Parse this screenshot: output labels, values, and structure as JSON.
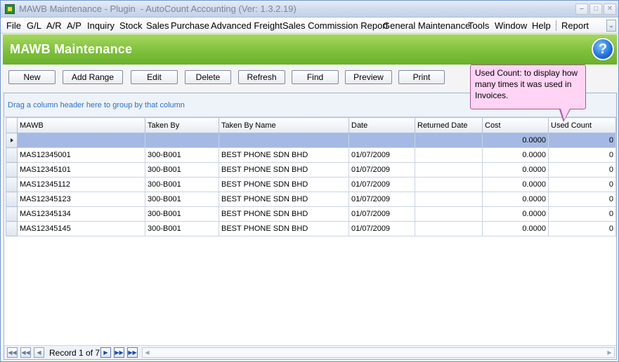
{
  "window": {
    "title": "MAWB Maintenance - Plugin  - AutoCount Accounting (Ver: 1.3.2.19)"
  },
  "menu": {
    "items": [
      "File",
      "G/L",
      "A/R",
      "A/P",
      "Inquiry",
      "Stock",
      "Sales",
      "Purchase",
      "Advanced Freight",
      "Sales Commission Report",
      "General Maintenance",
      "Tools",
      "Window",
      "Help",
      "Report"
    ]
  },
  "banner": {
    "title": "MAWB Maintenance",
    "help_glyph": "?"
  },
  "toolbar": {
    "new": "New",
    "add_range": "Add Range",
    "edit": "Edit",
    "delete": "Delete",
    "refresh": "Refresh",
    "find": "Find",
    "preview": "Preview",
    "print": "Print"
  },
  "tooltip": {
    "text": "Used Count: to display how many times it was used in Invoices."
  },
  "grid": {
    "group_hint": "Drag a column header here to group by that column",
    "columns": [
      "MAWB",
      "Taken By",
      "Taken By Name",
      "Date",
      "Returned Date",
      "Cost",
      "Used Count"
    ],
    "new_row": {
      "mawb": "",
      "taken_by": "",
      "taken_by_name": "",
      "date": "",
      "returned_date": "",
      "cost": "0.0000",
      "used_count": "0"
    },
    "rows": [
      {
        "mawb": "MAS12345001",
        "taken_by": "300-B001",
        "taken_by_name": "BEST PHONE SDN BHD",
        "date": "01/07/2009",
        "returned_date": "",
        "cost": "0.0000",
        "used_count": "0"
      },
      {
        "mawb": "MAS12345101",
        "taken_by": "300-B001",
        "taken_by_name": "BEST PHONE SDN BHD",
        "date": "01/07/2009",
        "returned_date": "",
        "cost": "0.0000",
        "used_count": "0"
      },
      {
        "mawb": "MAS12345112",
        "taken_by": "300-B001",
        "taken_by_name": "BEST PHONE SDN BHD",
        "date": "01/07/2009",
        "returned_date": "",
        "cost": "0.0000",
        "used_count": "0"
      },
      {
        "mawb": "MAS12345123",
        "taken_by": "300-B001",
        "taken_by_name": "BEST PHONE SDN BHD",
        "date": "01/07/2009",
        "returned_date": "",
        "cost": "0.0000",
        "used_count": "0"
      },
      {
        "mawb": "MAS12345134",
        "taken_by": "300-B001",
        "taken_by_name": "BEST PHONE SDN BHD",
        "date": "01/07/2009",
        "returned_date": "",
        "cost": "0.0000",
        "used_count": "0"
      },
      {
        "mawb": "MAS12345145",
        "taken_by": "300-B001",
        "taken_by_name": "BEST PHONE SDN BHD",
        "date": "01/07/2009",
        "returned_date": "",
        "cost": "0.0000",
        "used_count": "0"
      }
    ]
  },
  "navigator": {
    "record_text": "Record 1 of 7"
  },
  "colors": {
    "banner": "#7fc03c",
    "selected_row": "#a5b9e4",
    "tooltip": "#ffd4f4",
    "hint_text": "#2b72c8"
  }
}
